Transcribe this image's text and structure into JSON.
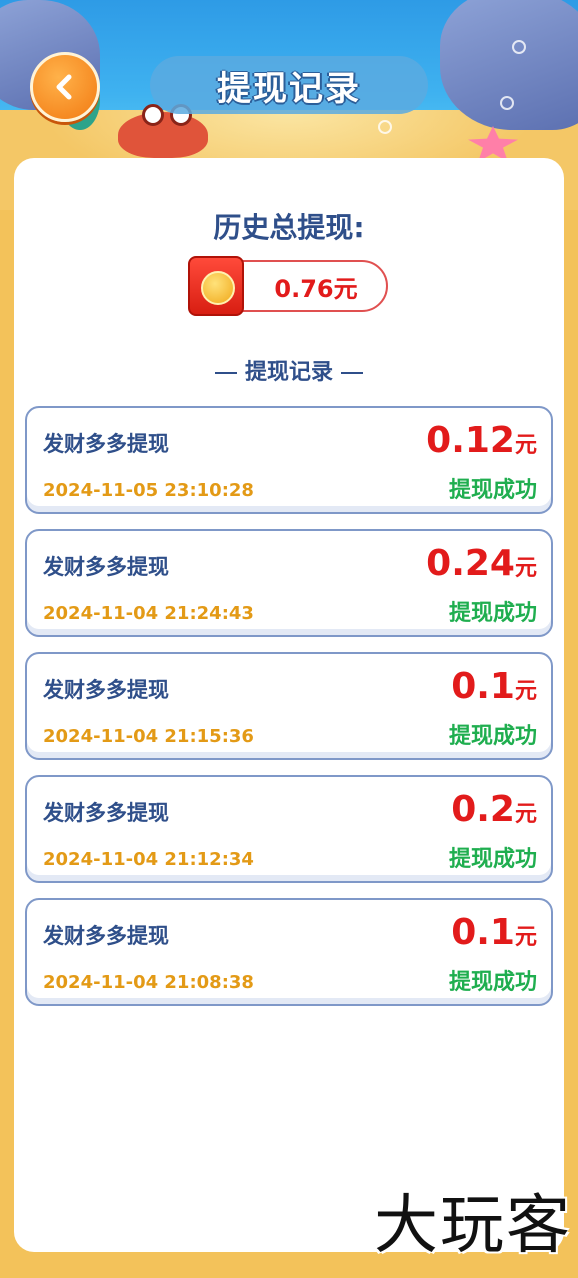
{
  "header": {
    "title": "提现记录",
    "back_icon": "chevron-left-icon"
  },
  "summary": {
    "label": "历史总提现:",
    "total": "0.76元"
  },
  "section_title": "提现记录",
  "records": [
    {
      "name": "发财多多提现",
      "time": "2024-11-05 23:10:28",
      "amount": "0.12",
      "unit": "元",
      "status": "提现成功"
    },
    {
      "name": "发财多多提现",
      "time": "2024-11-04 21:24:43",
      "amount": "0.24",
      "unit": "元",
      "status": "提现成功"
    },
    {
      "name": "发财多多提现",
      "time": "2024-11-04 21:15:36",
      "amount": "0.1",
      "unit": "元",
      "status": "提现成功"
    },
    {
      "name": "发财多多提现",
      "time": "2024-11-04 21:12:34",
      "amount": "0.2",
      "unit": "元",
      "status": "提现成功"
    },
    {
      "name": "发财多多提现",
      "time": "2024-11-04 21:08:38",
      "amount": "0.1",
      "unit": "元",
      "status": "提现成功"
    }
  ],
  "watermark": "大玩客",
  "colors": {
    "amount_red": "#e21b1b",
    "status_green": "#1fae4f",
    "time_orange": "#e39a16",
    "text_navy": "#2f4f8a",
    "frame_gold": "#f3c25a"
  }
}
